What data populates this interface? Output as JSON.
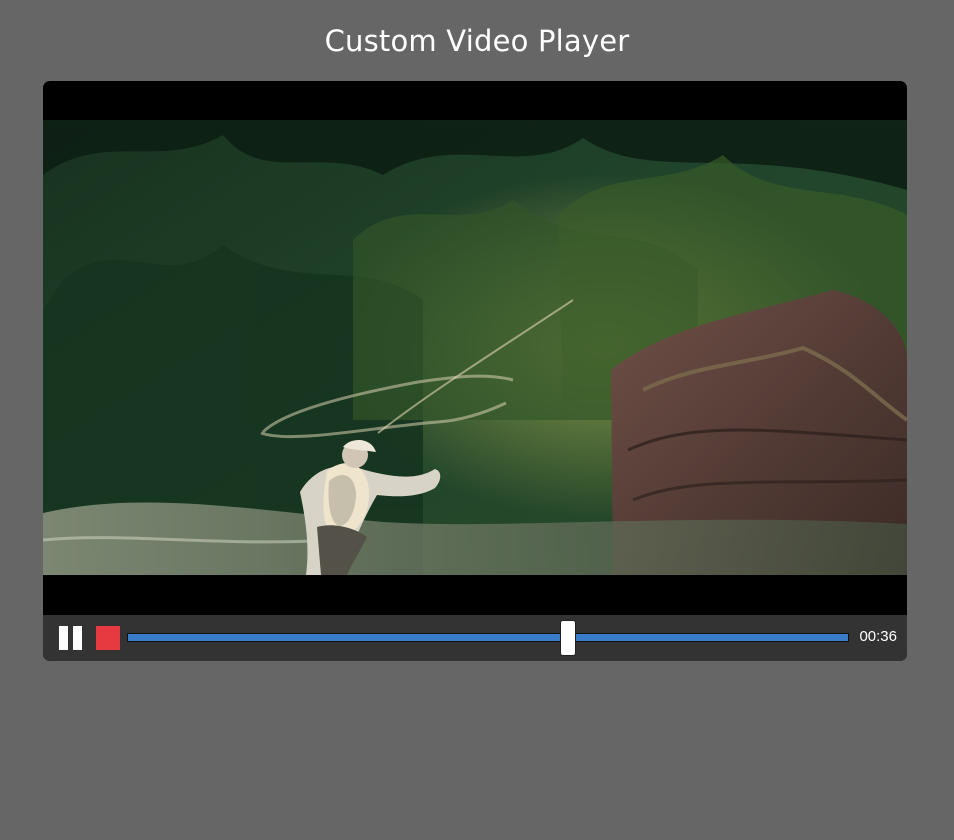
{
  "page": {
    "title": "Custom Video Player"
  },
  "video": {
    "scene": "fly-fishing-river"
  },
  "controls": {
    "pause_icon": "pause-icon",
    "stop_icon": "stop-icon",
    "progress_fraction": 0.611,
    "time": "00:36",
    "accent_color": "#3a7cc8",
    "stop_color": "#e53a3f"
  }
}
